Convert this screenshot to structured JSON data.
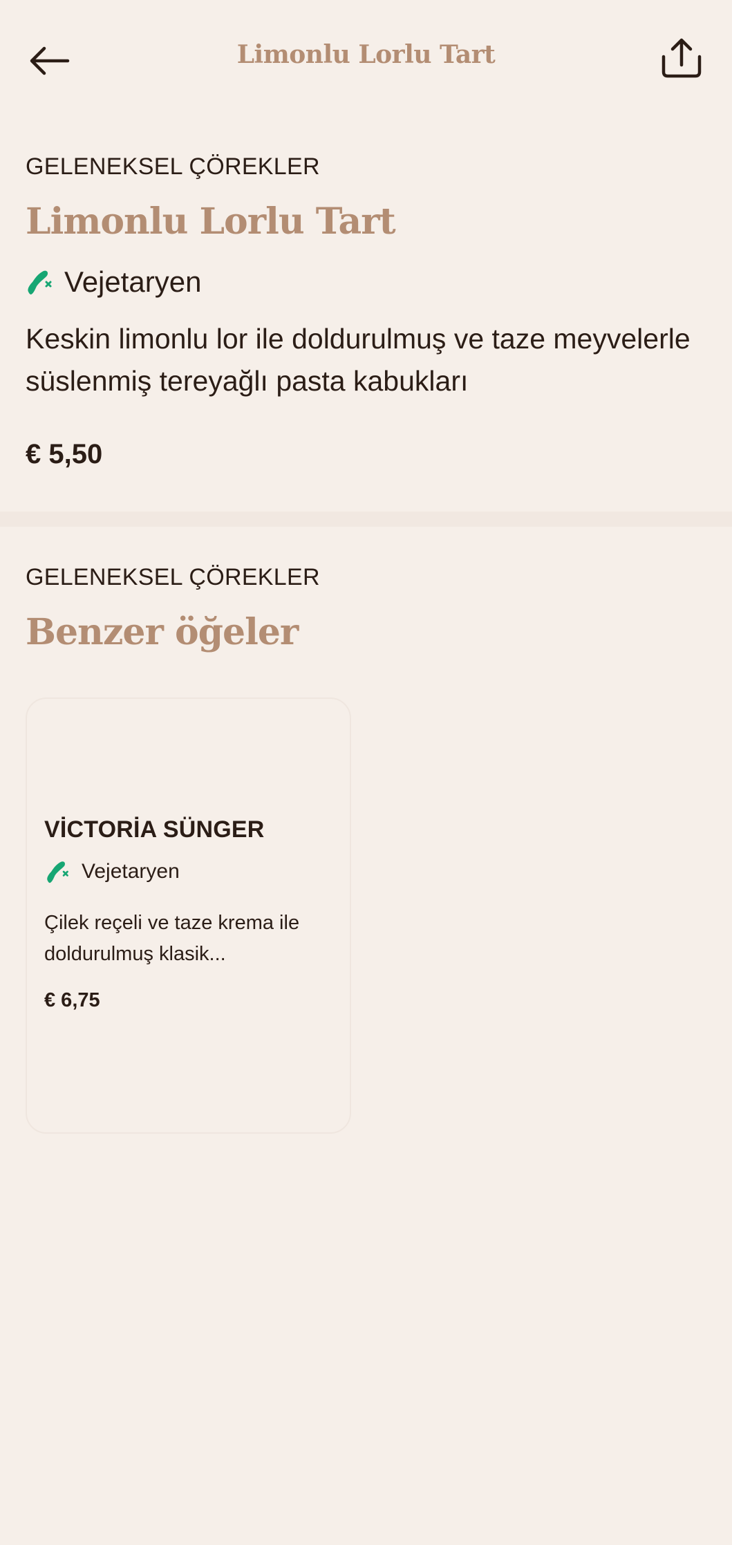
{
  "topbar": {
    "title": "Limonlu Lorlu Tart",
    "back_icon": "arrow-left-icon",
    "share_icon": "share-icon"
  },
  "item": {
    "category": "GELENEKSEL ÇÖREKLER",
    "name": "Limonlu Lorlu Tart",
    "diet_label": "Vejetaryen",
    "diet_icon": "vegetarian-icon",
    "description": "Keskin limonlu lor ile doldurulmuş ve taze meyvelerle süslenmiş tereyağlı pasta kabukları",
    "price": "€ 5,50"
  },
  "similar": {
    "category": "GELENEKSEL ÇÖREKLER",
    "heading": "Benzer öğeler",
    "items": [
      {
        "name": "VİCTORİA SÜNGER",
        "diet_label": "Vejetaryen",
        "description": "Çilek reçeli ve taze krema ile doldurulmuş klasik...",
        "price": "€ 6,75"
      }
    ]
  },
  "colors": {
    "background": "#f6efe9",
    "accent": "#b38d73",
    "text": "#2b1d16",
    "vegetarian_green": "#17a673"
  }
}
